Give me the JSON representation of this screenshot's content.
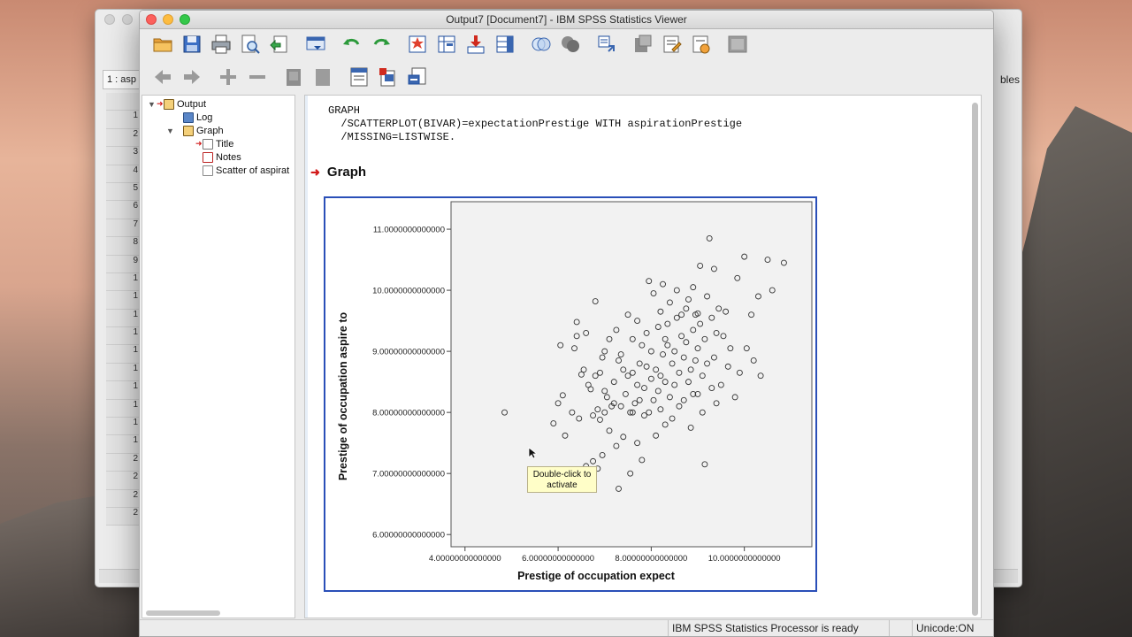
{
  "window": {
    "title": "Output7 [Document7] - IBM SPSS Statistics Viewer"
  },
  "background_window": {
    "cell_ref": "1 : asp",
    "right_label": "bles",
    "row_numbers": [
      "",
      "1",
      "2",
      "3",
      "4",
      "5",
      "6",
      "7",
      "8",
      "9",
      "1",
      "1",
      "1",
      "1",
      "1",
      "1",
      "1",
      "1",
      "1",
      "1",
      "2",
      "2",
      "2",
      "2"
    ]
  },
  "toolbar": {
    "row1_icons": [
      "open-folder-icon",
      "save-icon",
      "print-icon",
      "print-preview-icon",
      "export-icon",
      "recall-dialog-icon",
      "undo-icon",
      "redo-icon",
      "goto-case-icon",
      "goto-variable-icon",
      "insert-cases-icon",
      "insert-variable-icon",
      "show-all-icon",
      "hide-icon",
      "promote-icon",
      "designate-window-icon",
      "new-title-icon",
      "new-text-icon",
      "chart-icon",
      "disabled-window-icon"
    ],
    "row2_icons": [
      "back-icon",
      "forward-icon",
      "expand-icon",
      "collapse-icon",
      "show-icon",
      "hide-items-icon",
      "insert-heading-icon",
      "insert-title-icon",
      "insert-text-icon"
    ]
  },
  "outline": {
    "items": [
      {
        "label": "Output",
        "level": 0
      },
      {
        "label": "Log",
        "level": 1
      },
      {
        "label": "Graph",
        "level": 1
      },
      {
        "label": "Title",
        "level": 2
      },
      {
        "label": "Notes",
        "level": 2
      },
      {
        "label": "Scatter of aspirat",
        "level": 2
      }
    ]
  },
  "content": {
    "syntax": "GRAPH\n  /SCATTERPLOT(BIVAR)=expectationPrestige WITH aspirationPrestige\n  /MISSING=LISTWISE.",
    "heading": "Graph",
    "tooltip": "Double-click to activate"
  },
  "status": {
    "processor": "IBM SPSS Statistics Processor is ready",
    "unicode": "Unicode:ON"
  },
  "chart_data": {
    "type": "scatter",
    "xlabel": "Prestige of occupation expect",
    "ylabel": "Prestige of occupation aspire to",
    "xlim": [
      3.7,
      11.45
    ],
    "ylim": [
      5.8,
      11.45
    ],
    "xticks": [
      4,
      6,
      8,
      10
    ],
    "yticks": [
      6,
      7,
      8,
      9,
      10,
      11
    ],
    "xtick_labels": [
      "4.00000000000000",
      "6.00000000000000",
      "8.00000000000000",
      "10.0000000000000"
    ],
    "ytick_labels": [
      "6.00000000000000",
      "7.00000000000000",
      "8.00000000000000",
      "9.00000000000000",
      "10.0000000000000",
      "11.0000000000000"
    ],
    "grid": false,
    "colors": {
      "marker": "#333333",
      "plot_bg": "#f2f2f2",
      "frame": "#2a4fb8"
    },
    "points": [
      [
        4.85,
        8.0
      ],
      [
        5.9,
        7.82
      ],
      [
        6.0,
        8.15
      ],
      [
        6.05,
        9.1
      ],
      [
        6.1,
        8.28
      ],
      [
        6.15,
        7.62
      ],
      [
        6.3,
        8.0
      ],
      [
        6.35,
        9.05
      ],
      [
        6.4,
        9.48
      ],
      [
        6.4,
        9.25
      ],
      [
        6.45,
        7.9
      ],
      [
        6.5,
        8.62
      ],
      [
        6.55,
        8.7
      ],
      [
        6.55,
        7.05
      ],
      [
        6.6,
        9.3
      ],
      [
        6.6,
        7.12
      ],
      [
        6.65,
        8.45
      ],
      [
        6.7,
        8.38
      ],
      [
        6.75,
        7.2
      ],
      [
        6.75,
        7.95
      ],
      [
        6.8,
        8.6
      ],
      [
        6.8,
        9.82
      ],
      [
        6.85,
        8.05
      ],
      [
        6.85,
        7.08
      ],
      [
        6.9,
        8.65
      ],
      [
        6.9,
        7.88
      ],
      [
        6.95,
        8.9
      ],
      [
        7.0,
        8.0
      ],
      [
        7.0,
        8.35
      ],
      [
        7.05,
        8.25
      ],
      [
        7.1,
        7.7
      ],
      [
        7.1,
        9.2
      ],
      [
        7.15,
        8.1
      ],
      [
        7.2,
        8.5
      ],
      [
        7.25,
        9.35
      ],
      [
        7.25,
        7.45
      ],
      [
        7.3,
        8.85
      ],
      [
        7.3,
        6.75
      ],
      [
        7.35,
        8.95
      ],
      [
        7.35,
        8.1
      ],
      [
        7.4,
        8.7
      ],
      [
        7.4,
        7.6
      ],
      [
        7.45,
        8.3
      ],
      [
        7.5,
        8.6
      ],
      [
        7.5,
        9.6
      ],
      [
        7.55,
        8.0
      ],
      [
        7.55,
        7.0
      ],
      [
        7.6,
        8.65
      ],
      [
        7.6,
        9.2
      ],
      [
        7.65,
        8.15
      ],
      [
        7.7,
        9.5
      ],
      [
        7.7,
        7.5
      ],
      [
        7.75,
        8.8
      ],
      [
        7.75,
        8.2
      ],
      [
        7.8,
        9.1
      ],
      [
        7.8,
        7.22
      ],
      [
        7.85,
        8.4
      ],
      [
        7.85,
        7.95
      ],
      [
        7.9,
        8.75
      ],
      [
        7.9,
        9.3
      ],
      [
        7.95,
        8.0
      ],
      [
        7.95,
        10.15
      ],
      [
        8.0,
        8.55
      ],
      [
        8.0,
        9.0
      ],
      [
        8.05,
        8.2
      ],
      [
        8.05,
        9.95
      ],
      [
        8.1,
        8.7
      ],
      [
        8.1,
        7.62
      ],
      [
        8.15,
        9.4
      ],
      [
        8.15,
        8.35
      ],
      [
        8.2,
        9.65
      ],
      [
        8.2,
        8.05
      ],
      [
        8.25,
        8.95
      ],
      [
        8.25,
        10.1
      ],
      [
        8.3,
        8.5
      ],
      [
        8.3,
        7.8
      ],
      [
        8.35,
        9.1
      ],
      [
        8.35,
        9.45
      ],
      [
        8.4,
        8.25
      ],
      [
        8.4,
        9.8
      ],
      [
        8.45,
        8.8
      ],
      [
        8.45,
        7.9
      ],
      [
        8.5,
        9.0
      ],
      [
        8.5,
        8.45
      ],
      [
        8.55,
        9.55
      ],
      [
        8.55,
        10.0
      ],
      [
        8.6,
        8.65
      ],
      [
        8.6,
        8.1
      ],
      [
        8.65,
        9.25
      ],
      [
        8.65,
        9.6
      ],
      [
        8.7,
        8.9
      ],
      [
        8.7,
        8.2
      ],
      [
        8.75,
        9.7
      ],
      [
        8.75,
        9.15
      ],
      [
        8.8,
        8.5
      ],
      [
        8.8,
        9.85
      ],
      [
        8.85,
        8.7
      ],
      [
        8.85,
        7.75
      ],
      [
        8.9,
        9.35
      ],
      [
        8.9,
        10.05
      ],
      [
        8.95,
        8.85
      ],
      [
        8.95,
        9.6
      ],
      [
        9.0,
        8.3
      ],
      [
        9.0,
        9.05
      ],
      [
        9.05,
        9.45
      ],
      [
        9.05,
        10.4
      ],
      [
        9.1,
        8.6
      ],
      [
        9.1,
        8.0
      ],
      [
        9.15,
        9.2
      ],
      [
        9.15,
        7.15
      ],
      [
        9.2,
        8.8
      ],
      [
        9.2,
        9.9
      ],
      [
        9.25,
        10.85
      ],
      [
        9.3,
        8.4
      ],
      [
        9.3,
        9.55
      ],
      [
        9.35,
        10.35
      ],
      [
        9.35,
        8.9
      ],
      [
        9.4,
        8.15
      ],
      [
        9.45,
        9.7
      ],
      [
        9.5,
        8.45
      ],
      [
        9.55,
        9.25
      ],
      [
        9.6,
        9.65
      ],
      [
        9.65,
        8.75
      ],
      [
        9.7,
        9.05
      ],
      [
        9.8,
        8.25
      ],
      [
        9.85,
        10.2
      ],
      [
        9.9,
        8.65
      ],
      [
        10.0,
        10.55
      ],
      [
        10.05,
        9.05
      ],
      [
        10.15,
        9.6
      ],
      [
        10.2,
        8.85
      ],
      [
        10.3,
        9.9
      ],
      [
        10.35,
        8.6
      ],
      [
        10.5,
        10.5
      ],
      [
        10.6,
        10.0
      ],
      [
        10.85,
        10.45
      ],
      [
        9.0,
        9.62
      ],
      [
        8.2,
        8.6
      ],
      [
        7.7,
        8.45
      ],
      [
        7.0,
        9.0
      ],
      [
        6.95,
        7.3
      ],
      [
        7.6,
        8.0
      ],
      [
        8.9,
        8.3
      ],
      [
        9.4,
        9.3
      ],
      [
        8.3,
        9.2
      ],
      [
        7.2,
        8.15
      ]
    ]
  }
}
